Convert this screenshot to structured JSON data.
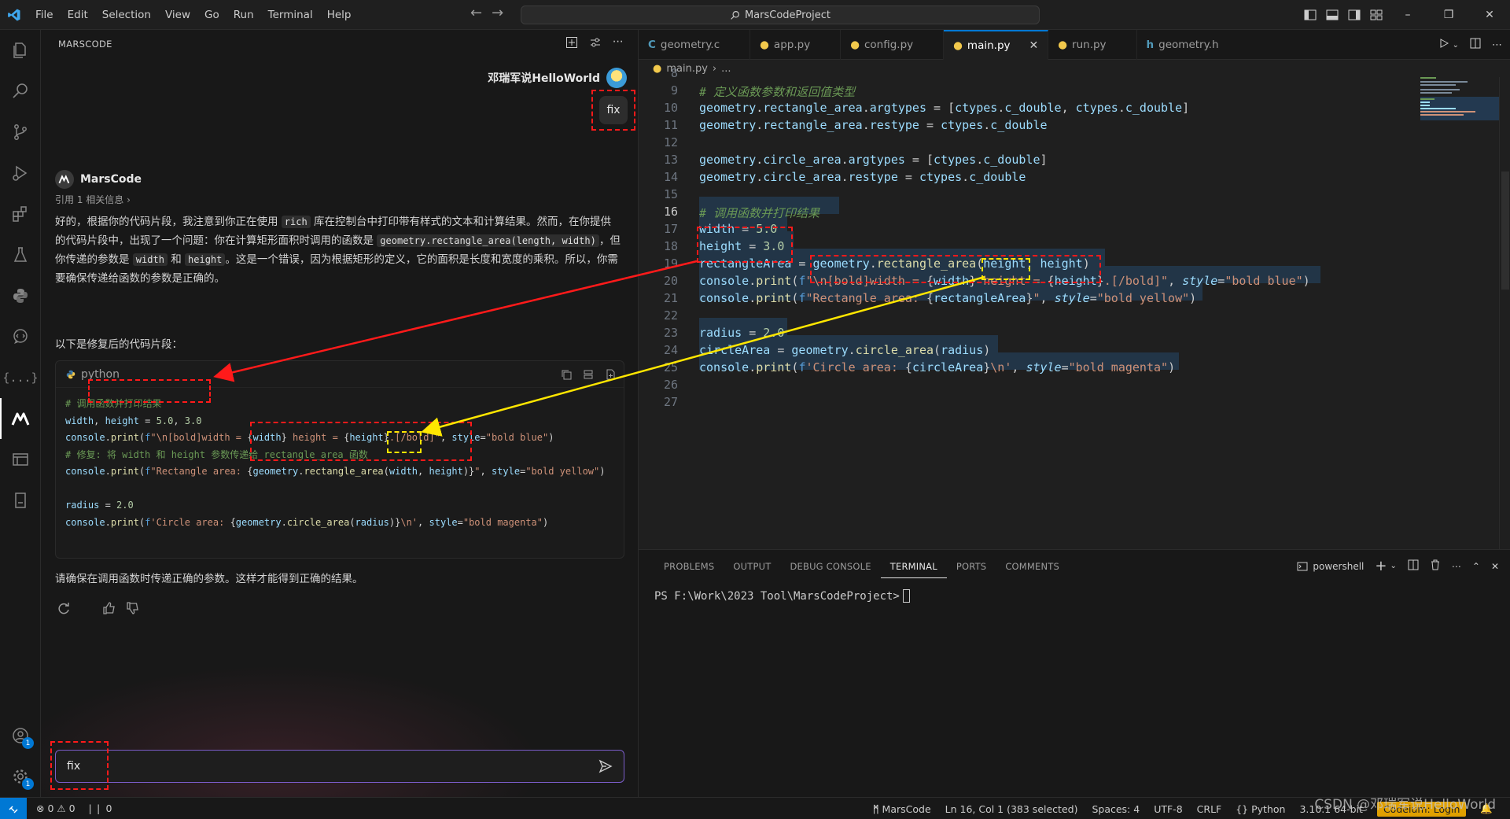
{
  "titlebar": {
    "menus": [
      "File",
      "Edit",
      "Selection",
      "View",
      "Go",
      "Run",
      "Terminal",
      "Help"
    ],
    "command_center": "MarsCodeProject"
  },
  "side": {
    "header": "MARSCODE",
    "user_name": "邓瑞军说HelloWorld",
    "user_message": "fix",
    "bot_name": "MarsCode",
    "reference": "引用 1 相关信息",
    "explain_1": "好的，根据你的代码片段，我注意到你正在使用",
    "explain_rich": "rich",
    "explain_2": "库在控制台中打印带有样式的文本和计算结果。然而，在你提供的代码片段中，出现了一个问题：你在计算矩形面积时调用的函数是",
    "explain_fn": "geometry.rectangle_area(length, width)",
    "explain_3": "，但你传递的参数是",
    "explain_w": "width",
    "explain_and": "和",
    "explain_h": "height",
    "explain_4": "。这是一个错误，因为根据矩形的定义，它的面积是长度和宽度的乘积。所以，你需要确保传递给函数的参数是正确的。",
    "intro": "以下是修复后的代码片段：",
    "code_lang": "python",
    "closing": "请确保在调用函数时传递正确的参数。这样才能得到正确的结果。",
    "input_value": "fix"
  },
  "editor": {
    "tabs": [
      {
        "label": "geometry.c",
        "icon": "c-file-icon"
      },
      {
        "label": "app.py",
        "icon": "python-file-icon"
      },
      {
        "label": "config.py",
        "icon": "python-file-icon"
      },
      {
        "label": "main.py",
        "icon": "python-file-icon",
        "active": true
      },
      {
        "label": "run.py",
        "icon": "python-file-icon"
      },
      {
        "label": "geometry.h",
        "icon": "h-file-icon"
      }
    ],
    "breadcrumb_file": "main.py",
    "breadcrumb_more": "...",
    "current_line": 16
  },
  "panel": {
    "tabs": [
      "PROBLEMS",
      "OUTPUT",
      "DEBUG CONSOLE",
      "TERMINAL",
      "PORTS",
      "COMMENTS"
    ],
    "active_tab": "TERMINAL",
    "shell": "powershell",
    "prompt": "PS F:\\Work\\2023 Tool\\MarsCodeProject>"
  },
  "status": {
    "errors": "0",
    "warnings": "0",
    "ports": "0",
    "marscode": "MarsCode",
    "position": "Ln 16, Col 1 (383 selected)",
    "spaces": "Spaces: 4",
    "encoding": "UTF-8",
    "eol": "CRLF",
    "language": "Python",
    "version": "3.10.1 64-bit",
    "codeium": "Codeium: Login"
  },
  "watermark": "CSDN @邓瑞军说HelloWorld",
  "colors": {
    "accent": "#0078d4",
    "annotation_red": "#ff1a1a",
    "annotation_yellow": "#ffe600"
  }
}
